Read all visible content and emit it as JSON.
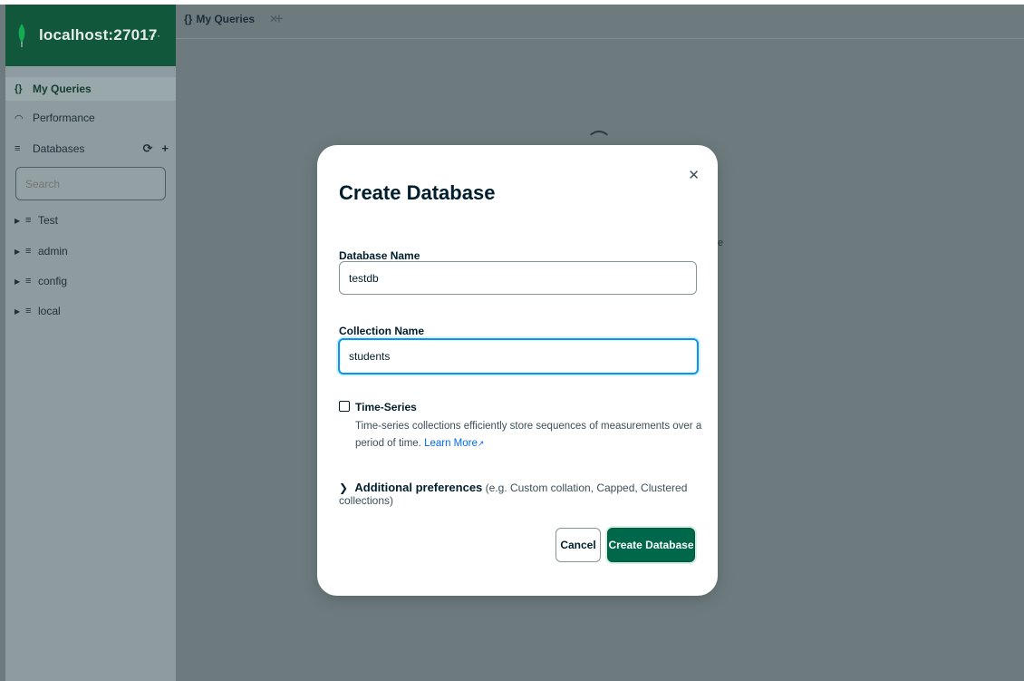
{
  "connection": {
    "name": "localhost:27017",
    "more": "···"
  },
  "sidebar": {
    "nav": [
      {
        "label": "My Queries",
        "icon": "{}"
      },
      {
        "label": "Performance",
        "icon": "◠"
      },
      {
        "label": "Databases",
        "icon": "≡"
      }
    ],
    "databases_actions": {
      "refresh": "⟳",
      "add": "+"
    },
    "search_placeholder": "Search",
    "databases": [
      {
        "name": "Test"
      },
      {
        "name": "admin"
      },
      {
        "name": "config"
      },
      {
        "name": "local"
      }
    ]
  },
  "tabs": [
    {
      "label": "My Queries",
      "icon": "{}",
      "close": "✕"
    }
  ],
  "tab_add": "+",
  "modal": {
    "title": "Create Database",
    "close": "✕",
    "database_name_label": "Database Name",
    "database_name_value": "testdb",
    "collection_name_label": "Collection Name",
    "collection_name_value": "students",
    "time_series_label": "Time-Series",
    "time_series_checked": false,
    "time_series_desc": "Time-series collections efficiently store sequences of measurements over a period of time.",
    "learn_more": "Learn More",
    "additional_title": "Additional preferences",
    "additional_hint": "(e.g. Custom collation, Capped, Clustered collections)",
    "cancel_label": "Cancel",
    "create_label": "Create Database"
  },
  "colors": {
    "brand_green": "#00684a",
    "header_green": "#11573c",
    "focus_blue": "#0498ec",
    "link_blue": "#016bf8"
  },
  "icons": {
    "leaf": "mongodb-leaf-icon",
    "queries": "braces-icon",
    "performance": "gauge-icon",
    "databases": "database-icon",
    "caret": "caret-right-icon",
    "external": "external-link-icon",
    "chevron": "chevron-right-icon"
  }
}
